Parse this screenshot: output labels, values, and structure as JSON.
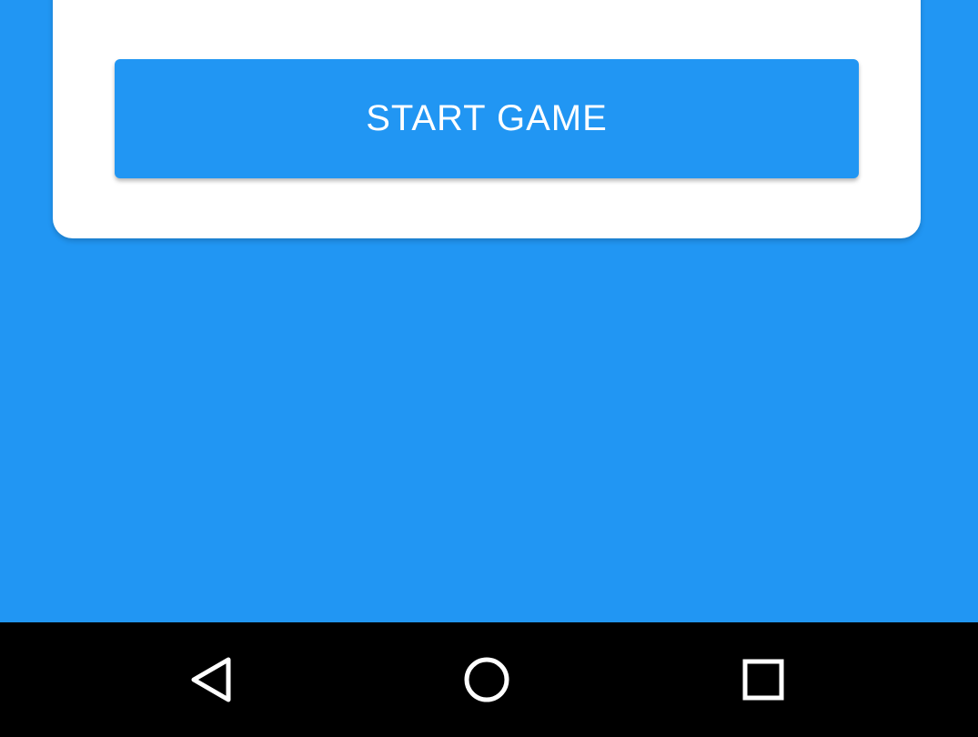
{
  "main": {
    "start_button_label": "START GAME"
  },
  "navigation_bar": {
    "icons": [
      "back-icon",
      "home-icon",
      "recents-icon"
    ]
  },
  "colors": {
    "background": "#2196F3",
    "card": "#FFFFFF",
    "button": "#2196F3",
    "button_text": "#FFFFFF",
    "nav_bar": "#000000",
    "nav_icons": "#FFFFFF"
  }
}
